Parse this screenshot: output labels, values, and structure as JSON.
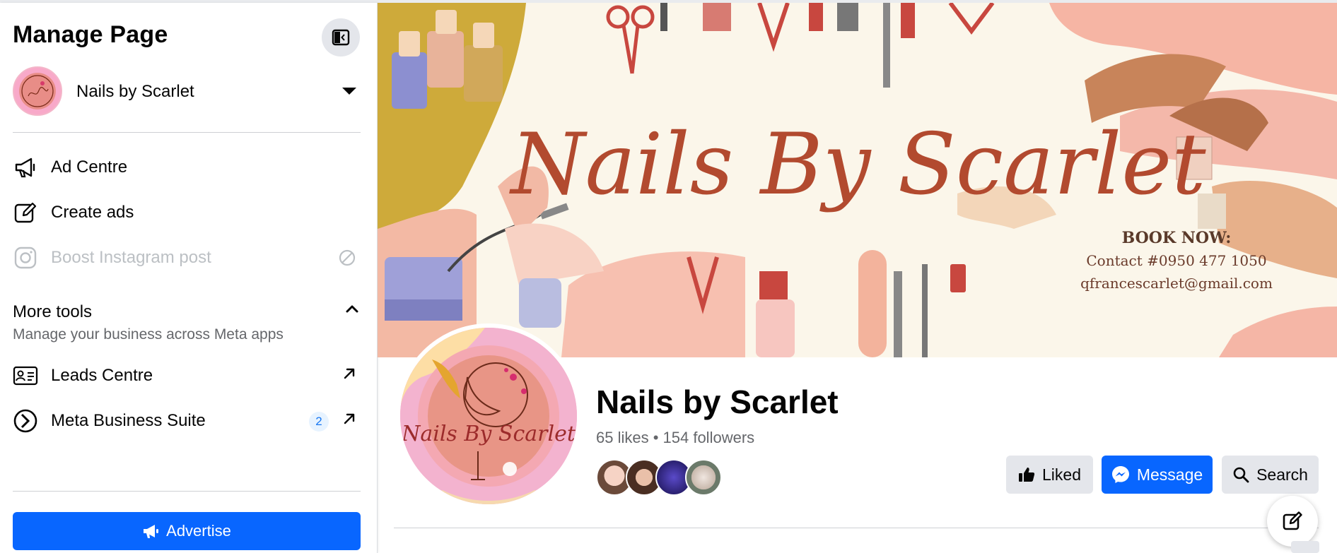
{
  "sidebar": {
    "title": "Manage Page",
    "page_name": "Nails by Scarlet",
    "items": [
      {
        "label": "Ad Centre"
      },
      {
        "label": "Create ads"
      },
      {
        "label": "Boost Instagram post"
      }
    ],
    "more_tools": {
      "title": "More tools",
      "subtitle": "Manage your business across Meta apps",
      "items": [
        {
          "label": "Leads Centre"
        },
        {
          "label": "Meta Business Suite",
          "badge": "2"
        }
      ]
    },
    "advertise_label": "Advertise"
  },
  "cover": {
    "brand_text": "Nails By Scarlet",
    "book_now": "BOOK NOW:",
    "contact": "Contact #0950 477 1050",
    "email": "qfrancescarlet@gmail.com"
  },
  "profile": {
    "logo_text": "Nails By Scarlet",
    "name": "Nails by Scarlet",
    "stats": "65 likes • 154 followers"
  },
  "actions": {
    "liked": "Liked",
    "message": "Message",
    "search": "Search"
  },
  "colors": {
    "accent": "#0866ff",
    "secondary_button": "#e4e6eb",
    "muted_text": "#65676b",
    "disabled_text": "#bcc0c4"
  }
}
